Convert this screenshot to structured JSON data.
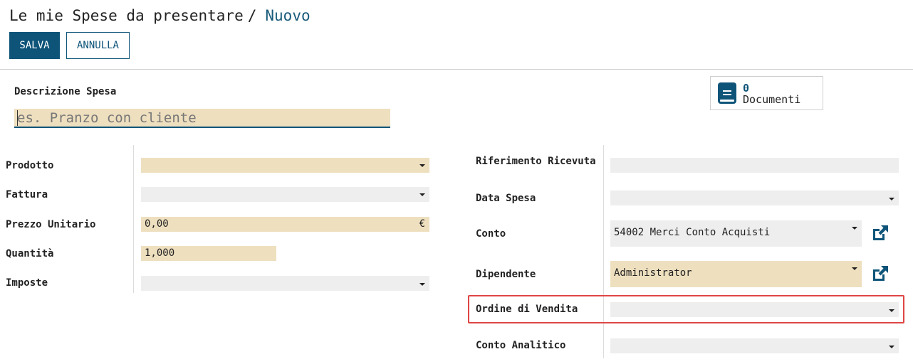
{
  "breadcrumb": {
    "parent": "Le mie Spese da presentare",
    "separator": "/",
    "current": "Nuovo"
  },
  "toolbar": {
    "save_label": "SALVA",
    "cancel_label": "ANNULLA"
  },
  "description": {
    "label": "Descrizione Spesa",
    "placeholder": "es. Pranzo con cliente",
    "value": ""
  },
  "documents": {
    "count": "0",
    "label": "Documenti",
    "icon": "book-icon"
  },
  "left_fields": [
    {
      "label": "Prodotto",
      "value": "",
      "style": "required",
      "widget": "select"
    },
    {
      "label": "Fattura",
      "value": "",
      "style": "optional",
      "widget": "select"
    },
    {
      "label": "Prezzo Unitario",
      "value": "0,00",
      "style": "required",
      "widget": "monetary",
      "currency": "€"
    },
    {
      "label": "Quantità",
      "value": "1,000",
      "style": "required",
      "widget": "float"
    },
    {
      "label": "Imposte",
      "value": "",
      "style": "optional",
      "widget": "tags"
    }
  ],
  "right_fields": [
    {
      "label": "Riferimento Ricevuta",
      "value": "",
      "style": "optional",
      "widget": "char"
    },
    {
      "label": "Data Spesa",
      "value": "",
      "style": "optional",
      "widget": "date"
    },
    {
      "label": "Conto",
      "value": "54002 Merci Conto Acquisti",
      "style": "optional",
      "widget": "many2one",
      "external_link": "external-link-icon"
    },
    {
      "label": "Dipendente",
      "value": "Administrator",
      "style": "required",
      "widget": "many2one",
      "external_link": "external-link-icon"
    },
    {
      "label": "Ordine di Vendita",
      "value": "",
      "style": "optional",
      "widget": "select",
      "highlighted": true
    },
    {
      "label": "Conto Analitico",
      "value": "",
      "style": "optional",
      "widget": "select"
    }
  ],
  "colors": {
    "primary": "#0e5479",
    "required_field": "#eedfbf",
    "optional_field": "#eeeeee",
    "highlight": "#e04545"
  }
}
